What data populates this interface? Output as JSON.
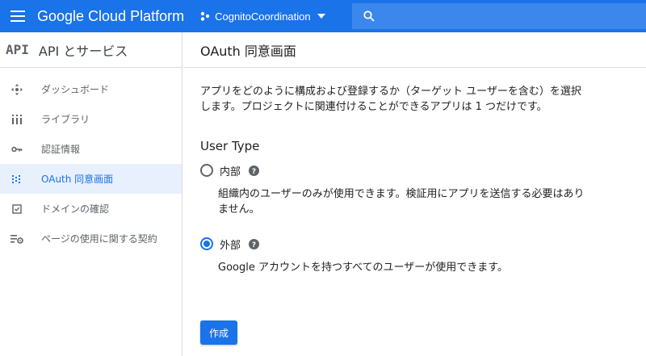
{
  "topbar": {
    "brand": "Google Cloud Platform",
    "project_name": "CognitoCoordination",
    "menu_icon": "hamburger-menu-icon",
    "search_icon": "search-icon",
    "color": "#1a73e8"
  },
  "sidebar": {
    "badge": "API",
    "title": "API とサービス",
    "items": [
      {
        "label": "ダッシュボード",
        "icon": "dashboard-icon",
        "active": false
      },
      {
        "label": "ライブラリ",
        "icon": "library-icon",
        "active": false
      },
      {
        "label": "認証情報",
        "icon": "key-icon",
        "active": false
      },
      {
        "label": "OAuth 同意画面",
        "icon": "oauth-consent-icon",
        "active": true
      },
      {
        "label": "ドメインの確認",
        "icon": "checkbox-icon",
        "active": false
      },
      {
        "label": "ページの使用に関する契約",
        "icon": "settings-list-icon",
        "active": false
      }
    ]
  },
  "main": {
    "title": "OAuth 同意画面",
    "description": "アプリをどのように構成および登録するか（ターゲット ユーザーを含む）を選択します。プロジェクトに関連付けることができるアプリは 1 つだけです。",
    "section_title": "User Type",
    "options": [
      {
        "label": "内部",
        "description": "組織内のユーザーのみが使用できます。検証用にアプリを送信する必要はありません。",
        "checked": false
      },
      {
        "label": "外部",
        "description": "Google アカウントを持つすべてのユーザーが使用できます。",
        "checked": true
      }
    ],
    "create_button": "作成"
  }
}
